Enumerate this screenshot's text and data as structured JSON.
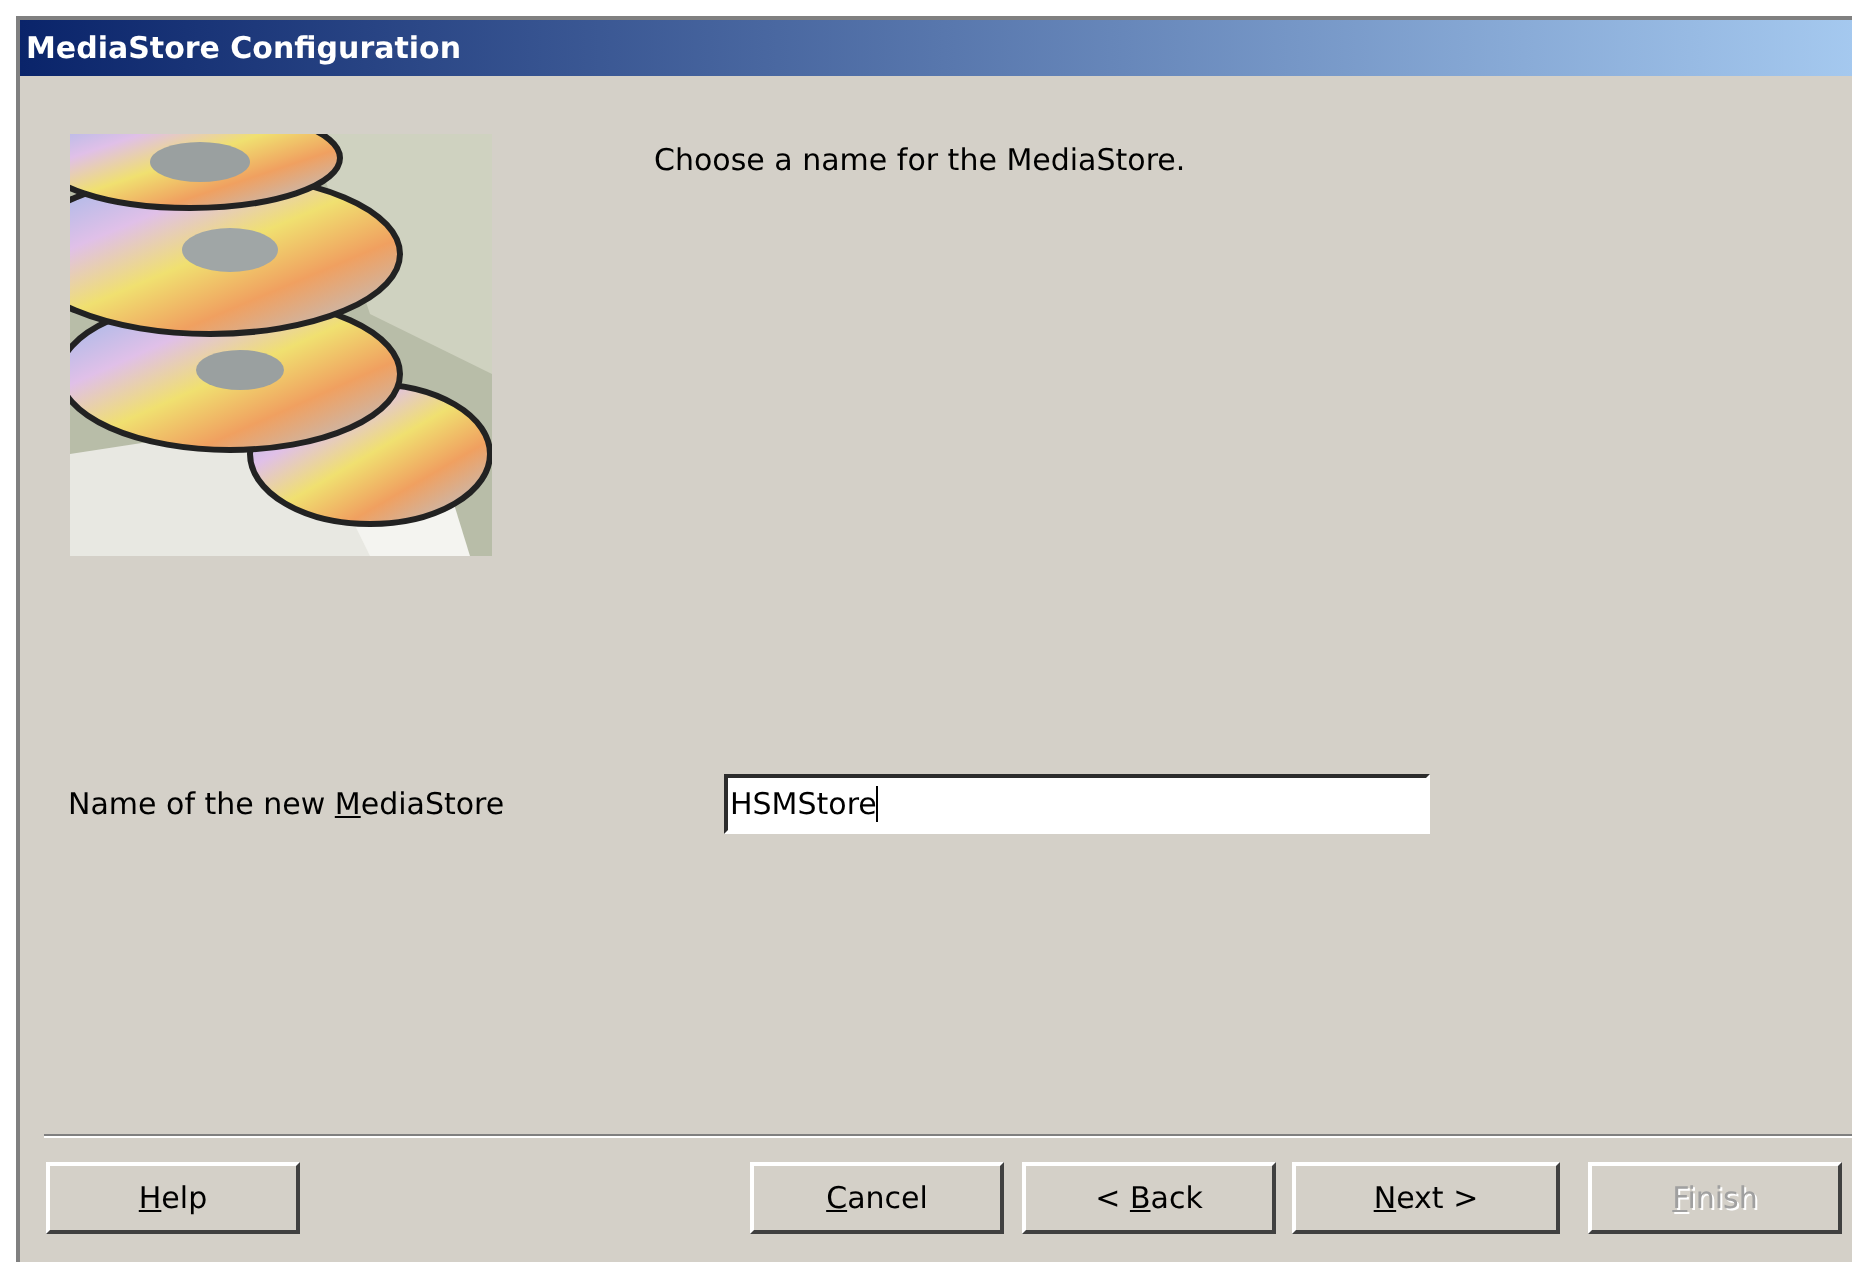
{
  "window": {
    "title": "MediaStore Configuration"
  },
  "prompt": "Choose a name for the MediaStore.",
  "name_field": {
    "label_parts": [
      {
        "text": "Name of the new ",
        "underlined": false
      },
      {
        "text": "M",
        "underlined": true
      },
      {
        "text": "ediaStore",
        "underlined": false
      }
    ],
    "value": "HSMStore"
  },
  "buttons": [
    {
      "label_parts": [
        {
          "text": "H",
          "underlined": true
        },
        {
          "text": "elp",
          "underlined": false
        }
      ],
      "disabled": false
    },
    {
      "label_parts": [
        {
          "text": "C",
          "underlined": true
        },
        {
          "text": "ancel",
          "underlined": false
        }
      ],
      "disabled": false
    },
    {
      "label_parts": [
        {
          "text": "< ",
          "underlined": false
        },
        {
          "text": "B",
          "underlined": true
        },
        {
          "text": "ack",
          "underlined": false
        }
      ],
      "disabled": false
    },
    {
      "label_parts": [
        {
          "text": "N",
          "underlined": true
        },
        {
          "text": "ext >",
          "underlined": false
        }
      ],
      "disabled": false
    },
    {
      "label_parts": [
        {
          "text": "F",
          "underlined": true
        },
        {
          "text": "inish",
          "underlined": false
        }
      ],
      "disabled": true
    }
  ]
}
